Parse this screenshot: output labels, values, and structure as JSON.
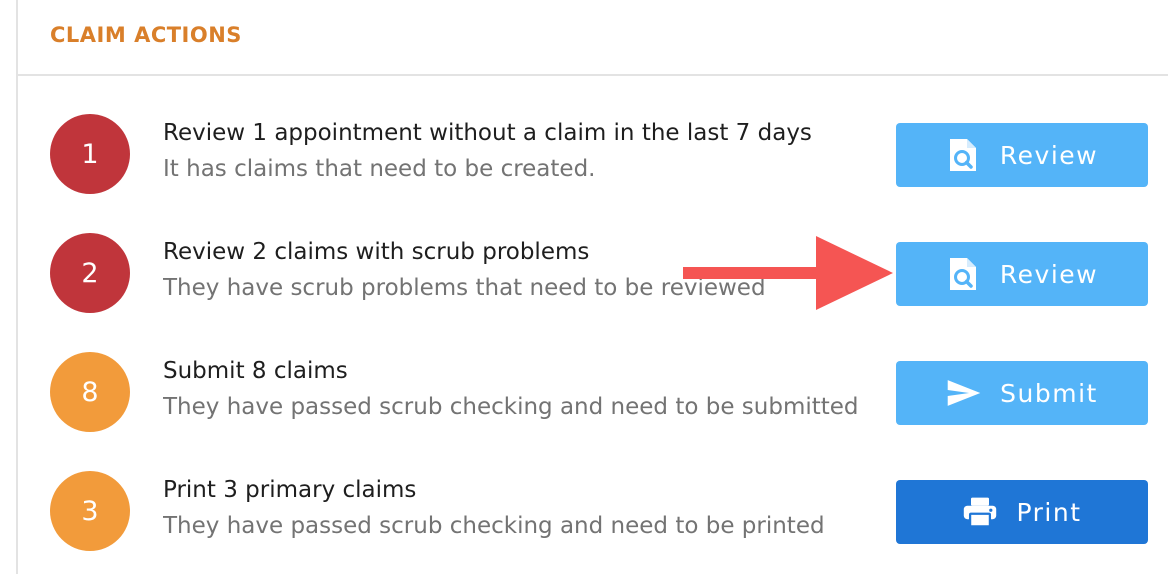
{
  "panel": {
    "title": "CLAIM ACTIONS"
  },
  "actions": [
    {
      "count": "1",
      "title": "Review 1 appointment without a claim in the last 7 days",
      "subtitle": "It has claims that need to be created.",
      "button_label": "Review",
      "button_icon": "document-search-icon",
      "badge_color": "#c0353b",
      "button_color": "#54b4f8"
    },
    {
      "count": "2",
      "title": "Review 2 claims with scrub problems",
      "subtitle": "They have scrub problems that need to be reviewed",
      "button_label": "Review",
      "button_icon": "document-search-icon",
      "badge_color": "#c0353b",
      "button_color": "#54b4f8"
    },
    {
      "count": "8",
      "title": "Submit 8 claims",
      "subtitle": "They have passed scrub checking and need to be submitted",
      "button_label": "Submit",
      "button_icon": "send-icon",
      "badge_color": "#f29b3b",
      "button_color": "#54b4f8"
    },
    {
      "count": "3",
      "title": "Print 3 primary claims",
      "subtitle": "They have passed scrub checking and need to be printed",
      "button_label": "Print",
      "button_icon": "printer-icon",
      "badge_color": "#f29b3b",
      "button_color": "#1f76d6"
    }
  ],
  "annotation": {
    "arrow_color": "#f55553",
    "arrow_icon": "annotation-arrow-icon"
  }
}
